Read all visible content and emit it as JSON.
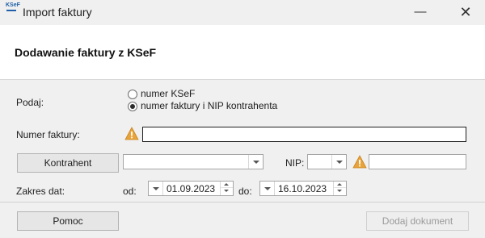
{
  "window": {
    "title": "Import faktury",
    "app_icon_text": "KSeF",
    "icons": {
      "minimize": "minimize-icon",
      "close": "close-icon"
    }
  },
  "header": {
    "title": "Dodawanie faktury z KSeF"
  },
  "form": {
    "podaj_label": "Podaj:",
    "radio_options": [
      {
        "label": "numer KSeF",
        "checked": false
      },
      {
        "label": "numer faktury i NIP kontrahenta",
        "checked": true
      }
    ],
    "invoice_number": {
      "label": "Numer faktury:",
      "value": "",
      "warning_icon": "warning-icon"
    },
    "contractor": {
      "button_label": "Kontrahent",
      "combo_value": ""
    },
    "nip": {
      "label": "NIP:",
      "prefix_value": "",
      "value": "",
      "warning_icon": "warning-icon"
    },
    "date_range": {
      "label": "Zakres dat:",
      "from_label": "od:",
      "from_value": "01.09.2023",
      "to_label": "do:",
      "to_value": "16.10.2023"
    }
  },
  "footer": {
    "help_label": "Pomoc",
    "add_label": "Dodaj dokument",
    "add_enabled": false
  },
  "colors": {
    "warning": "#e8a33a",
    "header_bg": "#ffffff",
    "window_bg": "#f0f0f0"
  }
}
